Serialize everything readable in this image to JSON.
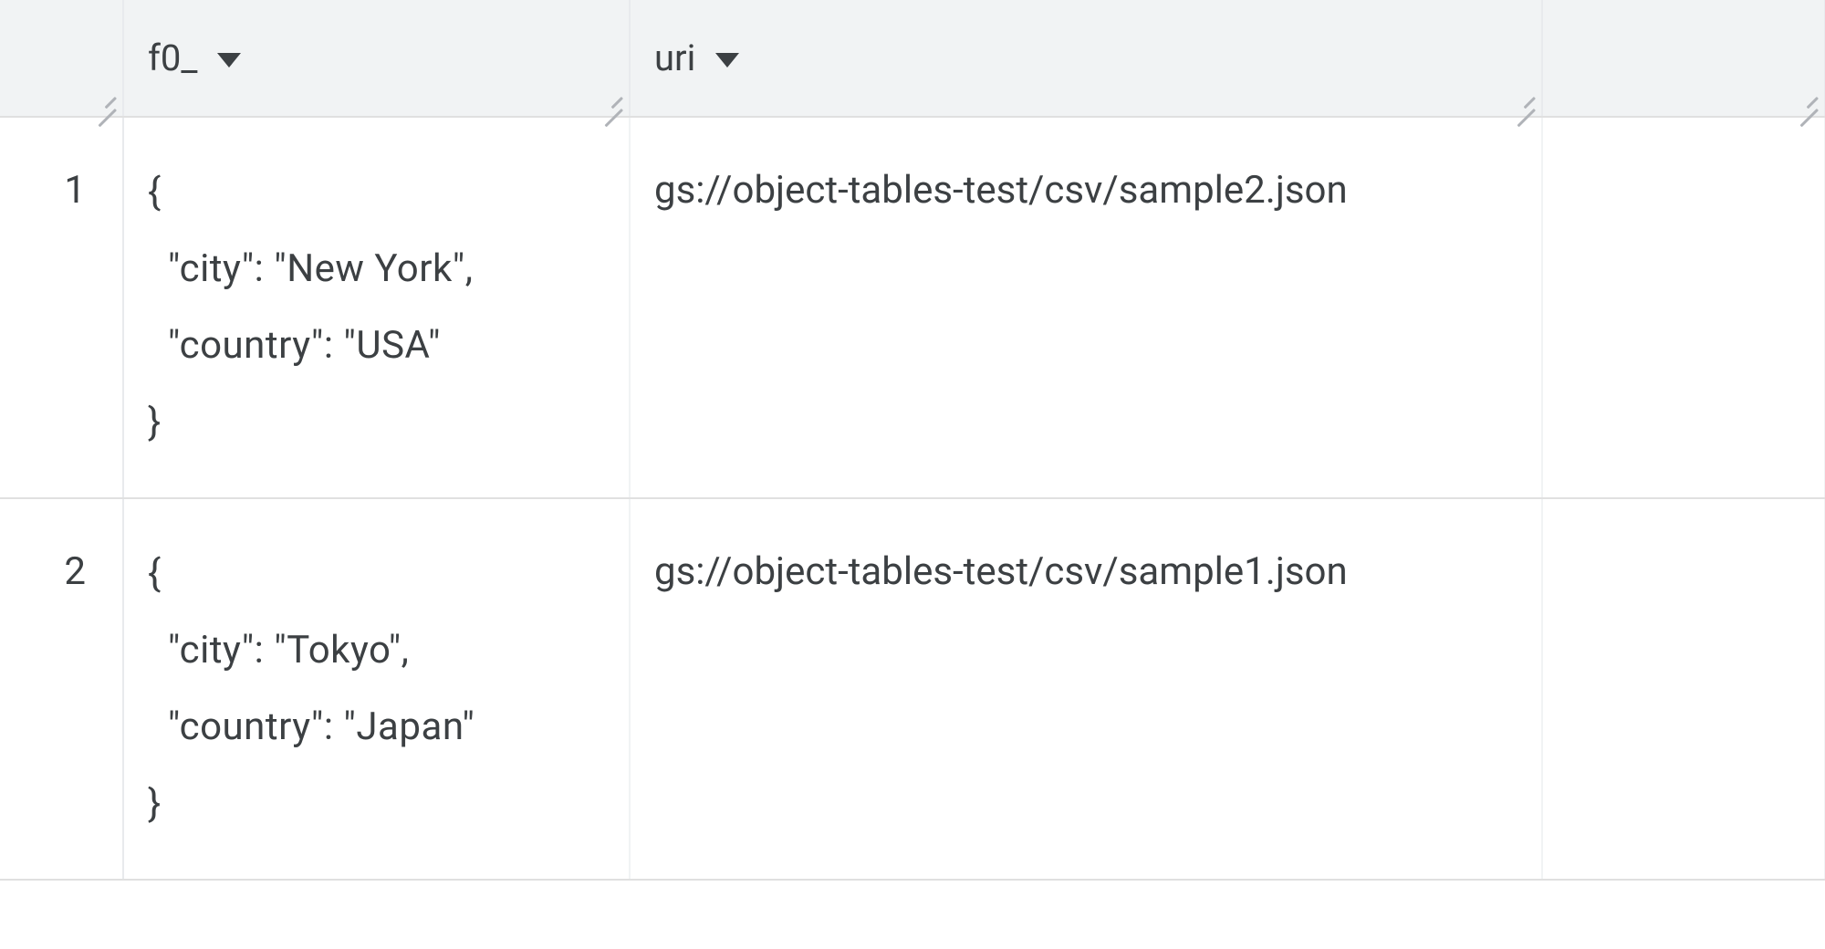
{
  "table": {
    "columns": [
      {
        "key": "rownum",
        "label": ""
      },
      {
        "key": "f0_",
        "label": "f0_"
      },
      {
        "key": "uri",
        "label": "uri"
      },
      {
        "key": "extra",
        "label": ""
      }
    ],
    "rows": [
      {
        "num": "1",
        "f0_": "{\n  \"city\": \"New York\",\n  \"country\": \"USA\"\n}",
        "uri": "gs://object-tables-test/csv/sample2.json"
      },
      {
        "num": "2",
        "f0_": "{\n  \"city\": \"Tokyo\",\n  \"country\": \"Japan\"\n}",
        "uri": "gs://object-tables-test/csv/sample1.json"
      }
    ]
  }
}
